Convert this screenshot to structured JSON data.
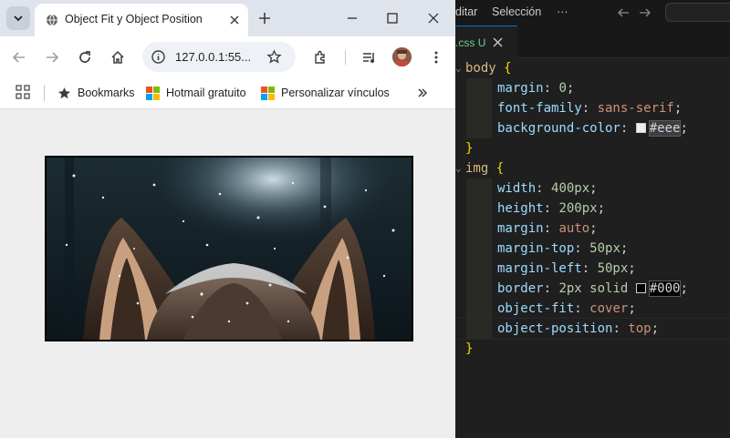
{
  "browser": {
    "tab_title": "Object Fit y Object Position",
    "url": "127.0.0.1:55...",
    "bookmarks": [
      {
        "label": "Bookmarks",
        "icon": "star-icon"
      },
      {
        "label": "Hotmail gratuito",
        "icon": "microsoft-logo-icon"
      },
      {
        "label": "Personalizar vínculos",
        "icon": "microsoft-logo-icon"
      }
    ],
    "page_background": "#eeeeee",
    "image_border_color": "#000000"
  },
  "editor": {
    "menu": [
      "ditar",
      "Selección",
      "···"
    ],
    "tab": {
      "name": ".css",
      "status": "U"
    },
    "colors": {
      "accent": "#0078d4",
      "modified": "#73c991"
    },
    "code": {
      "body_selector": "body",
      "body_decls": [
        {
          "prop": "margin",
          "value": "0",
          "type": "num"
        },
        {
          "prop": "font-family",
          "value": "sans-serif",
          "type": "val"
        },
        {
          "prop": "background-color",
          "value": "#eee",
          "type": "color",
          "swatch": "#eeeeee"
        }
      ],
      "img_selector": "img",
      "img_decls": [
        {
          "prop": "width",
          "value": "400px",
          "type": "num"
        },
        {
          "prop": "height",
          "value": "200px",
          "type": "num"
        },
        {
          "prop": "margin",
          "value": "auto",
          "type": "val"
        },
        {
          "prop": "margin-top",
          "value": "50px",
          "type": "num"
        },
        {
          "prop": "margin-left",
          "value": "50px",
          "type": "num"
        },
        {
          "prop": "border",
          "value": "2px solid",
          "type": "border",
          "color_value": "#000",
          "swatch": "#000000"
        },
        {
          "prop": "object-fit",
          "value": "cover",
          "type": "val"
        },
        {
          "prop": "object-position",
          "value": "top",
          "type": "val"
        }
      ]
    }
  }
}
